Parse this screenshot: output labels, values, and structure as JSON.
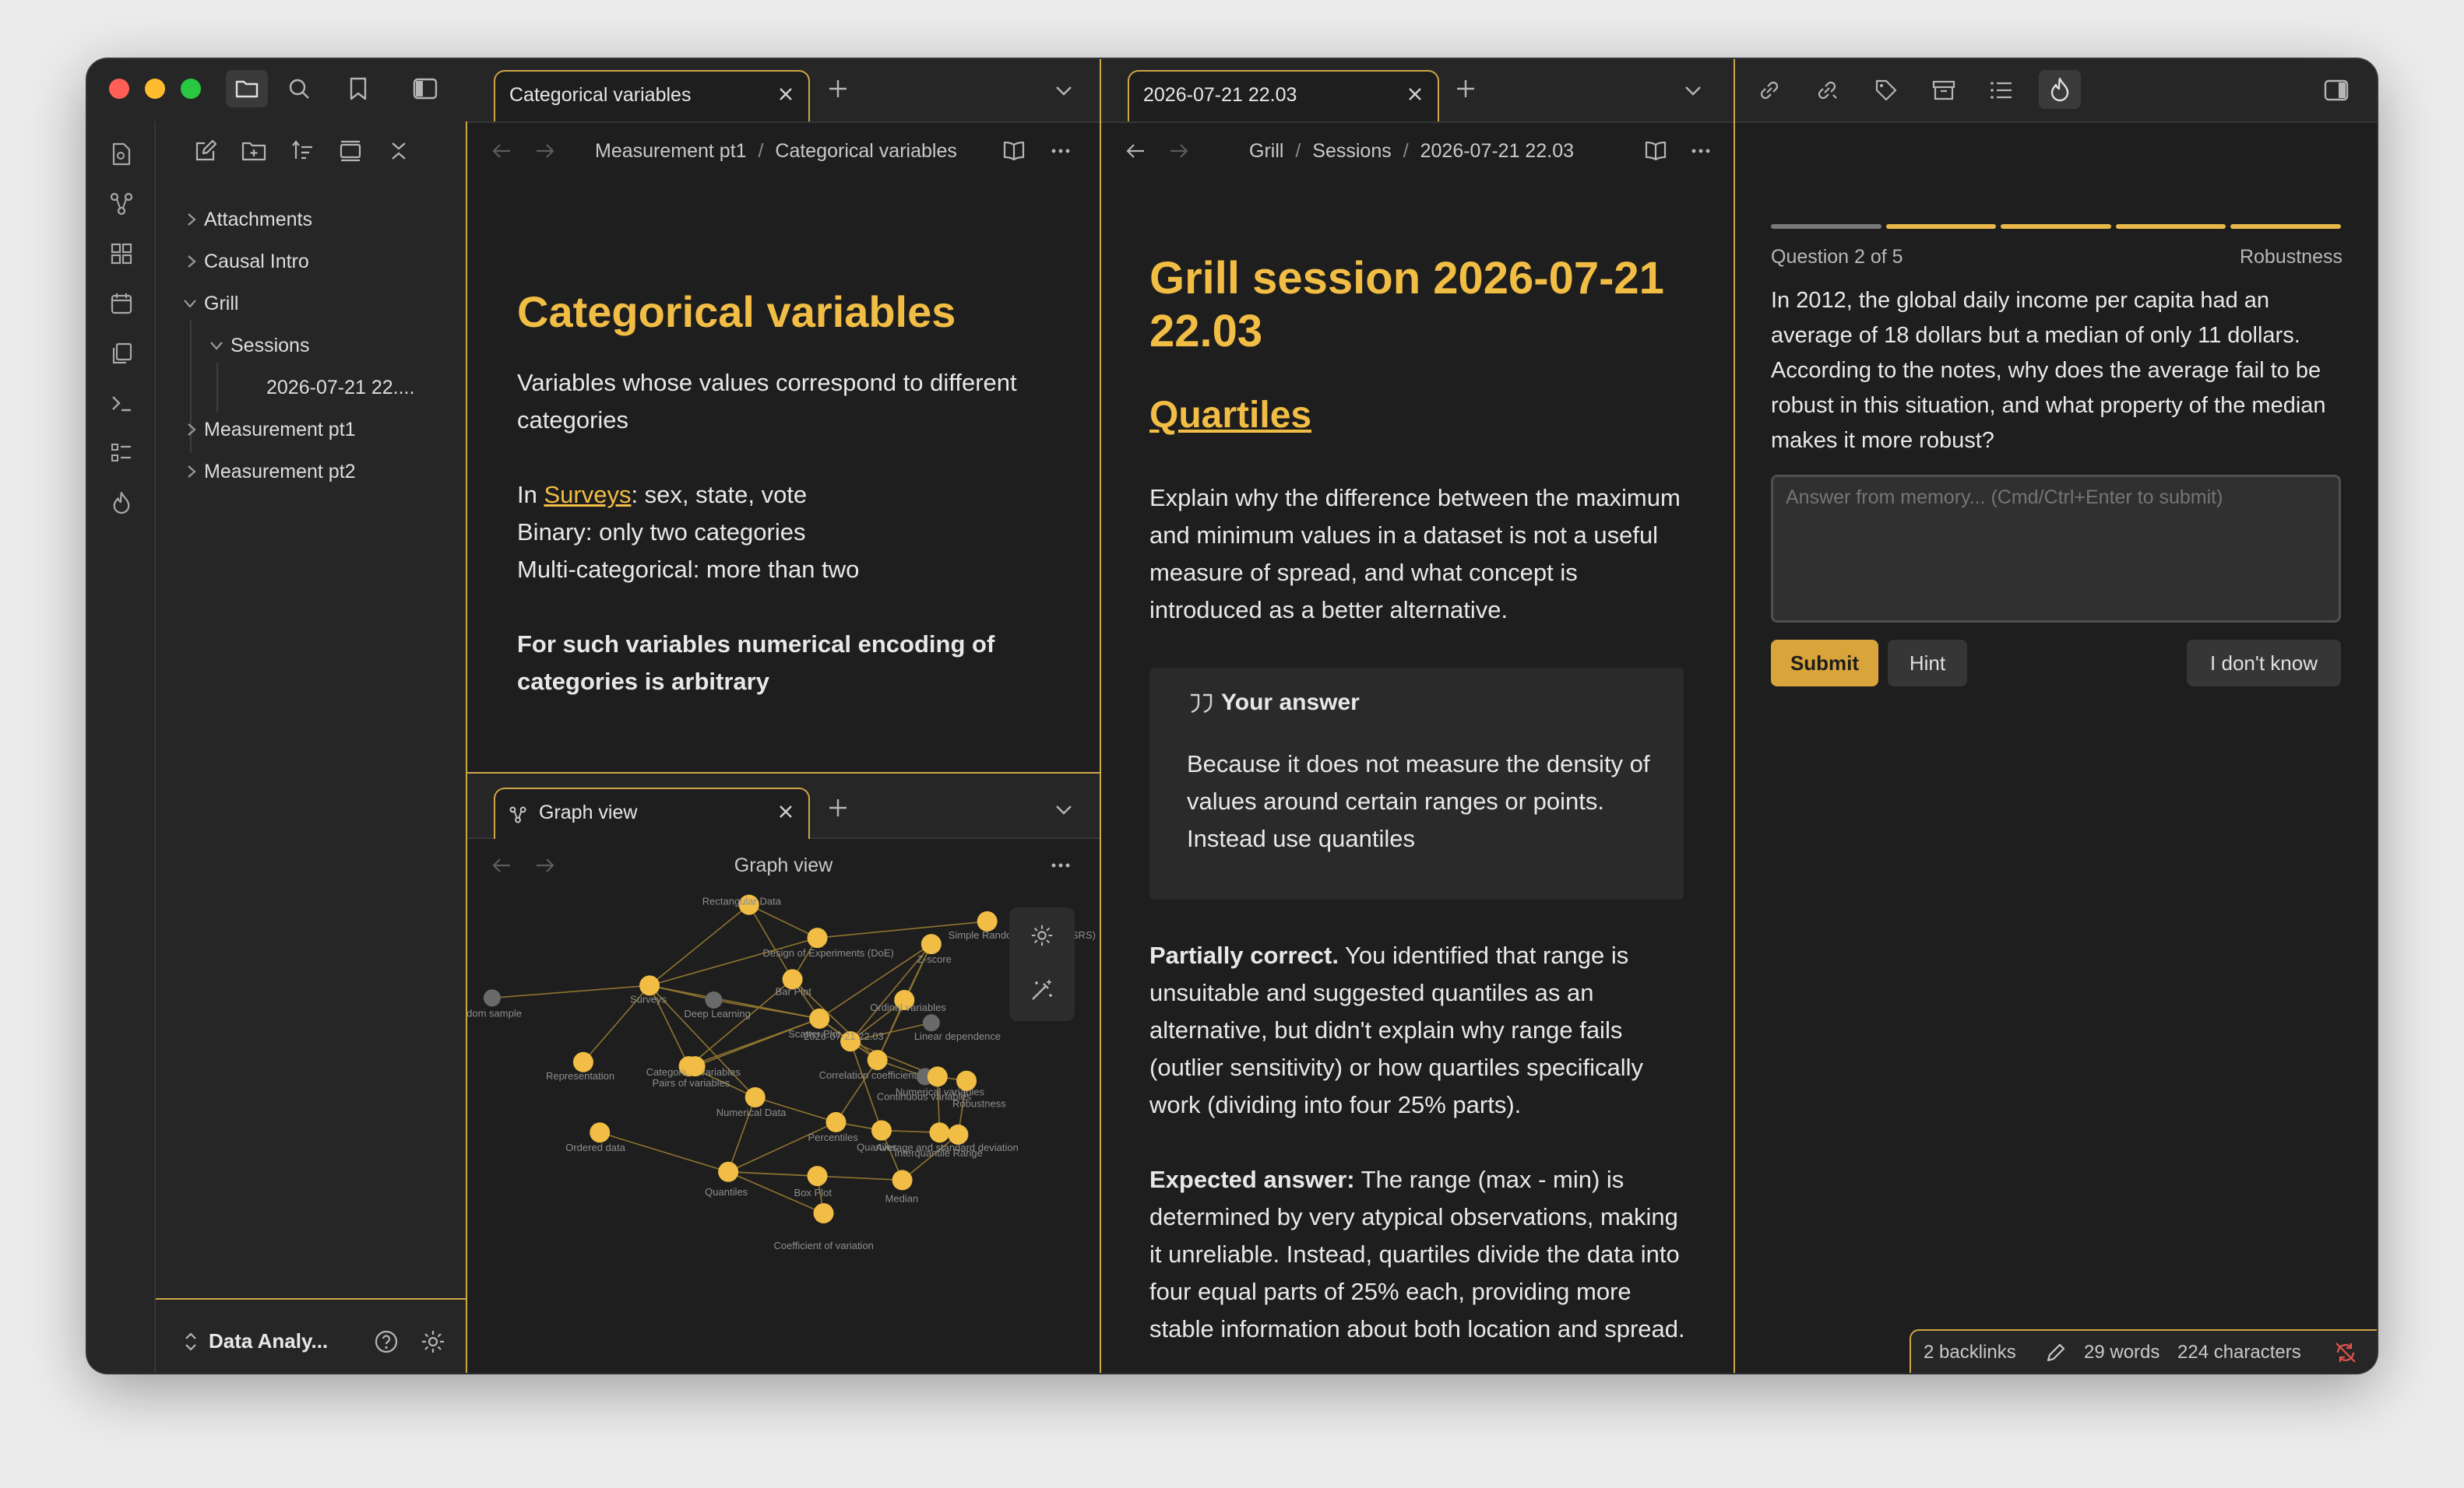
{
  "sidebar": {
    "items": [
      {
        "label": "Attachments"
      },
      {
        "label": "Causal Intro"
      },
      {
        "label": "Grill"
      },
      {
        "label": "Sessions"
      },
      {
        "label": "2026-07-21 22...."
      },
      {
        "label": "Measurement pt1"
      },
      {
        "label": "Measurement pt2"
      }
    ],
    "vault_name": "Data Analy..."
  },
  "left_pane": {
    "tab_title": "Categorical variables",
    "breadcrumb": [
      "Measurement pt1",
      "Categorical variables"
    ],
    "title": "Categorical variables",
    "p1": "Variables whose values correspond to different categories",
    "p2_prefix": "In ",
    "p2_link": "Surveys",
    "p2_suffix": ": sex, state, vote",
    "p3": "Binary: only two categories",
    "p4": "Multi-categorical: more than two",
    "p5": "For such variables numerical encoding of categories is arbitrary"
  },
  "graph_pane": {
    "tab_title": "Graph view",
    "header": "Graph view",
    "nodes": [
      {
        "label": "Rectangular Data"
      },
      {
        "label": "Simple Random Sampling (SRS)"
      },
      {
        "label": "Design of Experiments (DoE)"
      },
      {
        "label": "Z-score"
      },
      {
        "label": "Surveys"
      },
      {
        "label": "Bar Plot"
      },
      {
        "label": "ndom sample"
      },
      {
        "label": "Deep Learning"
      },
      {
        "label": "Ordinal variables"
      },
      {
        "label": "Scatter Plot"
      },
      {
        "label": "Linear dependence"
      },
      {
        "label": "2026-07-21 22.03"
      },
      {
        "label": "Categorical variables"
      },
      {
        "label": "Representation"
      },
      {
        "label": "Correlation coefficient"
      },
      {
        "label": "Pairs of variables"
      },
      {
        "label": "Continuous variables"
      },
      {
        "label": "Numerical variables"
      },
      {
        "label": "Robustness"
      },
      {
        "label": "Numerical Data"
      },
      {
        "label": "Percentiles"
      },
      {
        "label": "Quartiles"
      },
      {
        "label": "Average and standard deviation"
      },
      {
        "label": "Interquantile Range"
      },
      {
        "label": "Ordered data"
      },
      {
        "label": "Quantiles"
      },
      {
        "label": "Box Plot"
      },
      {
        "label": "Median"
      },
      {
        "label": "Coefficient of variation"
      }
    ]
  },
  "middle_pane": {
    "tab_title": "2026-07-21 22.03",
    "breadcrumb": [
      "Grill",
      "Sessions",
      "2026-07-21 22.03"
    ],
    "title": "Grill session 2026-07-21 22.03",
    "section": "Quartiles",
    "question": "Explain why the difference between the maximum and minimum values in a dataset is not a useful measure of spread, and what concept is introduced as a better alternative.",
    "answer_heading": "Your answer",
    "answer": "Because it does not measure the density of values around certain ranges or points. Instead use quantiles",
    "verdict_label": "Partially correct.",
    "verdict": " You identified that range is unsuitable and suggested quantiles as an alternative, but didn't explain why range fails (outlier sensitivity) or how quartiles specifically work (dividing into four 25% parts).",
    "expected_label": "Expected answer:",
    "expected": " The range (max - min) is determined by very atypical observations, making it unreliable. Instead, quartiles divide the data into four equal parts of 25% each, providing more stable information about both location and spread."
  },
  "right_pane": {
    "progress": {
      "current": 2,
      "total": 5
    },
    "question_label": "Question 2 of 5",
    "topic": "Robustness",
    "question": "In 2012, the global daily income per capita had an average of 18 dollars but a median of only 11 dollars. According to the notes, why does the average fail to be robust in this situation, and what property of the median makes it more robust?",
    "placeholder": "Answer from memory... (Cmd/Ctrl+Enter to submit)",
    "submit_label": "Submit",
    "hint_label": "Hint",
    "dont_know_label": "I don't know"
  },
  "status_bar": {
    "backlinks": "2 backlinks",
    "words": "29 words",
    "characters": "224 characters"
  },
  "colors": {
    "accent": "#cfa546",
    "heading": "#f1bd44",
    "background": "#1e1e1e"
  }
}
